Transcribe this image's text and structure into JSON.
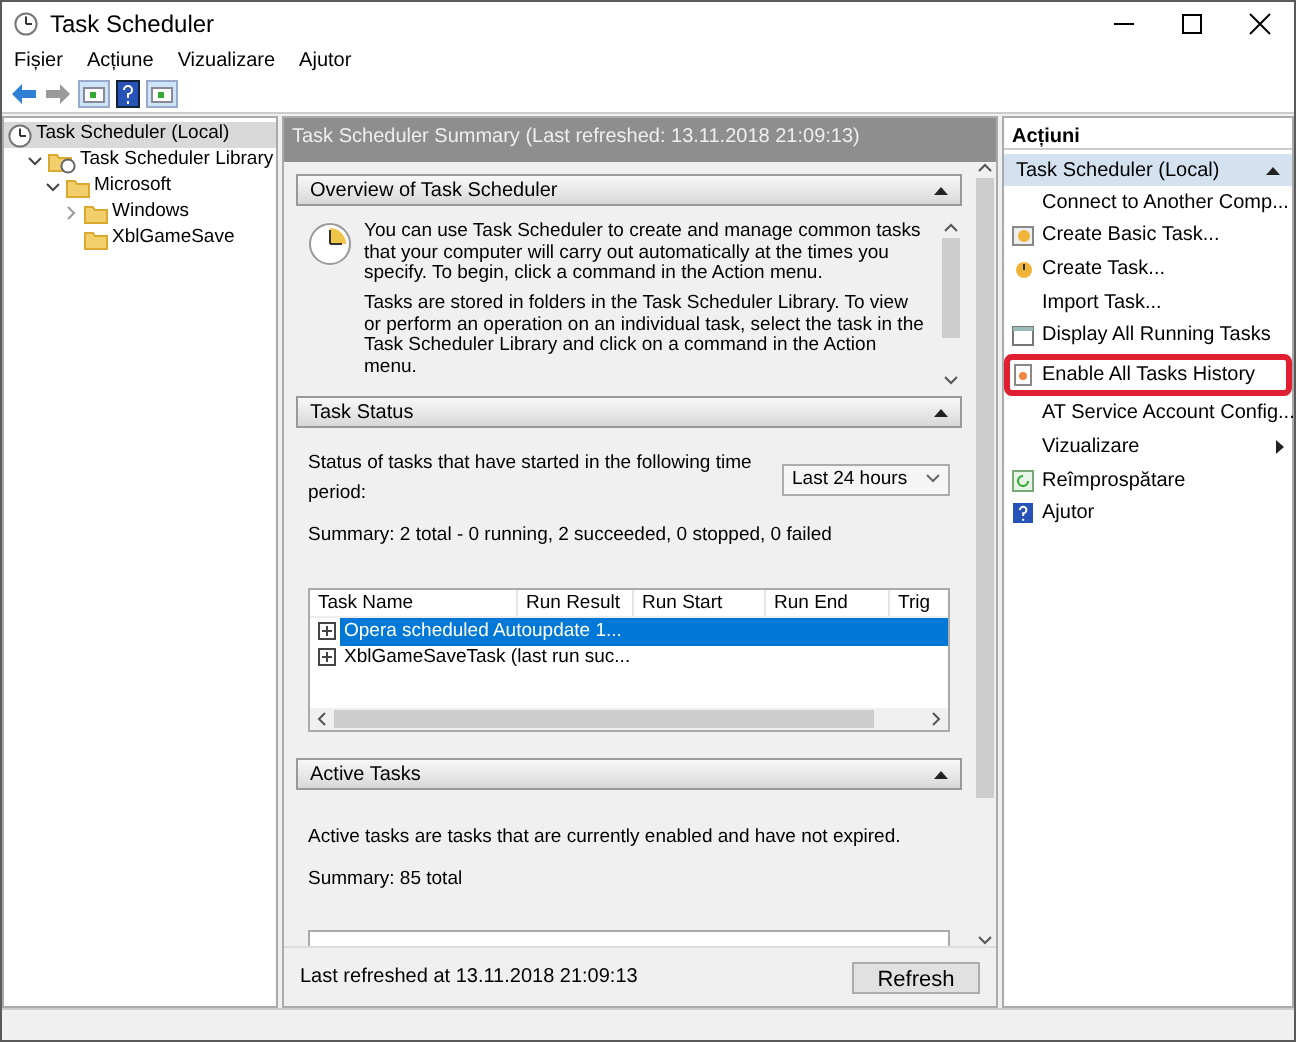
{
  "window": {
    "title": "Task Scheduler"
  },
  "menu": [
    "Fișier",
    "Acțiune",
    "Vizualizare",
    "Ajutor"
  ],
  "tree": [
    {
      "label": "Task Scheduler (Local)",
      "kind": "clock",
      "selected": true,
      "children": [
        {
          "label": "Task Scheduler Library",
          "kind": "library",
          "expanded": true,
          "selected": false,
          "children": [
            {
              "label": "Microsoft",
              "kind": "folder",
              "expanded": true,
              "selected": false,
              "children": [
                {
                  "label": "Windows",
                  "kind": "folder",
                  "expanded": false,
                  "selected": false
                },
                {
                  "label": "XblGameSave",
                  "kind": "folder",
                  "selected": false
                }
              ]
            }
          ]
        }
      ]
    }
  ],
  "summary_header": "Task Scheduler Summary (Last refreshed: 13.11.2018 21:09:13)",
  "overview": {
    "title": "Overview of Task Scheduler",
    "paragraphs": [
      "You can use Task Scheduler to create and manage common tasks that your computer will carry out automatically at the times you specify. To begin, click a command in the Action menu.",
      "Tasks are stored in folders in the Task Scheduler Library. To view or perform an operation on an individual task, select the task in the Task Scheduler Library and click on a command in the Action menu."
    ]
  },
  "task_status": {
    "title": "Task Status",
    "period_label": "Status of tasks that have started in the following time period:",
    "period": "Last 24 hours",
    "summary": "Summary: 2 total - 0 running, 2 succeeded, 0 stopped, 0 failed",
    "table": {
      "columns": [
        "Task Name",
        "Run Result",
        "Run Start",
        "Run End",
        "Trig"
      ],
      "rows": [
        {
          "name": "Opera scheduled Autoupdate 1...",
          "selected": true
        },
        {
          "name": "XblGameSaveTask (last run suc...",
          "selected": false
        }
      ]
    }
  },
  "active_tasks": {
    "title": "Active Tasks",
    "description": "Active tasks are tasks that are currently enabled and have not expired.",
    "summary": "Summary: 85 total"
  },
  "footer": {
    "last_refreshed": "Last refreshed at 13.11.2018 21:09:13",
    "refresh_button": "Refresh"
  },
  "actions": {
    "title": "Acțiuni",
    "group": "Task Scheduler (Local)",
    "items": [
      {
        "label": "Connect to Another Comp...",
        "kind": "none",
        "submenu": false,
        "highlighted": false
      },
      {
        "label": "Create Basic Task...",
        "kind": "wizard",
        "submenu": false,
        "highlighted": false
      },
      {
        "label": "Create Task...",
        "kind": "task",
        "submenu": false,
        "highlighted": false
      },
      {
        "label": "Import Task...",
        "kind": "none",
        "submenu": false,
        "highlighted": false
      },
      {
        "label": "Display All Running Tasks",
        "kind": "window",
        "submenu": false,
        "highlighted": false
      },
      {
        "label": "Enable All Tasks History",
        "kind": "history",
        "submenu": false,
        "highlighted": true
      },
      {
        "label": "AT Service Account Config...",
        "kind": "none",
        "submenu": false,
        "highlighted": false
      },
      {
        "label": "Vizualizare",
        "kind": "none",
        "submenu": true,
        "highlighted": false
      },
      {
        "label": "Reîmprospătare",
        "kind": "refresh",
        "submenu": false,
        "highlighted": false
      },
      {
        "label": "Ajutor",
        "kind": "help",
        "submenu": false,
        "highlighted": false
      }
    ]
  }
}
